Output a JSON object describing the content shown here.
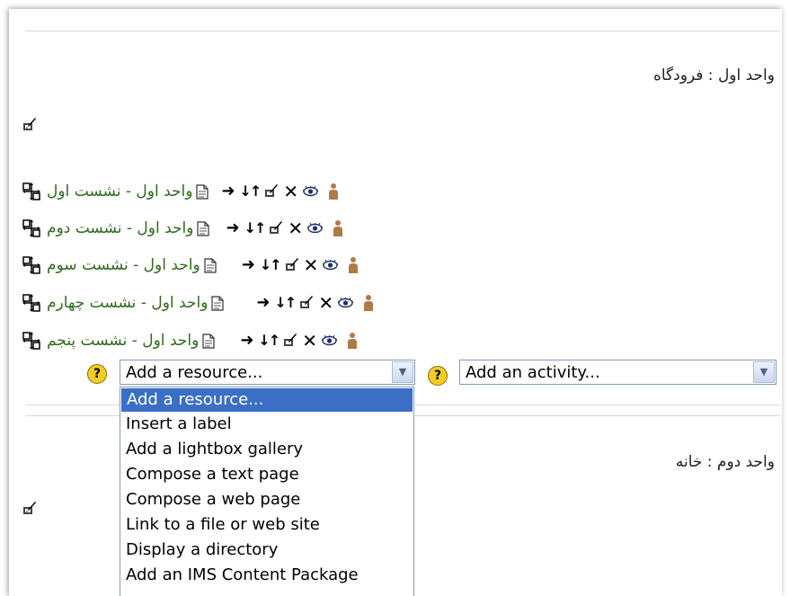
{
  "section1": {
    "title": "واحد اول : فرودگاه"
  },
  "lessons": [
    {
      "label": "واحد اول - نشست اول"
    },
    {
      "label": "واحد اول - نشست دوم"
    },
    {
      "label": "واحد اول - نشست سوم"
    },
    {
      "label": "واحد اول - نشست چهارم"
    },
    {
      "label": "واحد اول - نشست پنجم"
    }
  ],
  "resource_select": {
    "value": "Add a resource..."
  },
  "activity_select": {
    "value": "Add an activity..."
  },
  "help": {
    "glyph": "?"
  },
  "dropdown": {
    "options": [
      "Add a resource...",
      "Insert a label",
      "Add a lightbox gallery",
      "Compose a text page",
      "Compose a web page",
      "Link to a file or web site",
      "Display a directory",
      "Add an IMS Content Package"
    ],
    "selected_index": 0
  },
  "section2": {
    "title": "واحد دوم : خانه"
  },
  "icons": {
    "move": "move-arrows-icon",
    "page": "page-icon",
    "indent": "indent-right-arrow-icon",
    "moveupdown": "move-updown-icon",
    "edit": "pencil-edit-icon",
    "delete": "delete-x-icon",
    "visibility": "eye-icon",
    "roles": "person-role-icon"
  },
  "colors": {
    "link": "#2f6b1e",
    "selected": "#3b6fc6",
    "help": "#f3cc24"
  }
}
